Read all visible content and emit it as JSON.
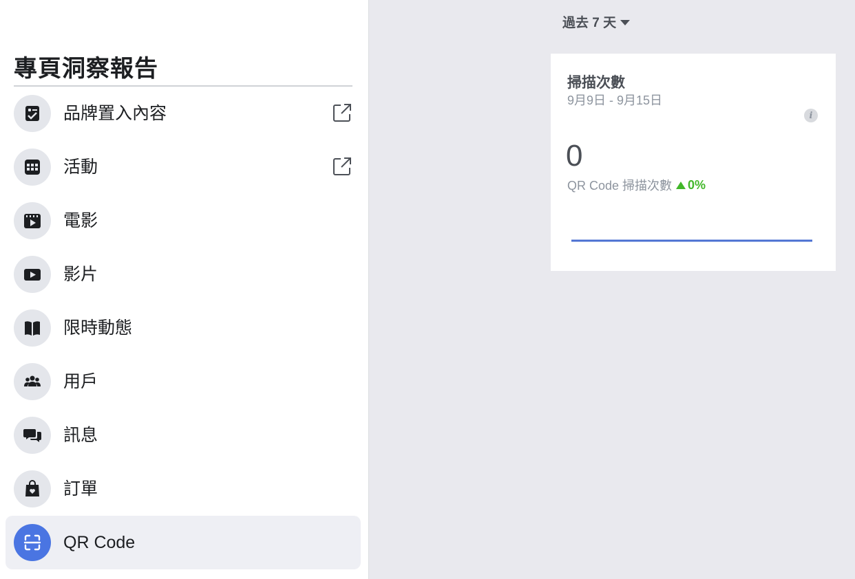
{
  "sidebar": {
    "title": "專頁洞察報告",
    "items": [
      {
        "label": "品牌置入內容",
        "icon": "branded-content-icon",
        "external": true
      },
      {
        "label": "活動",
        "icon": "calendar-icon",
        "external": true
      },
      {
        "label": "電影",
        "icon": "movie-icon",
        "external": false
      },
      {
        "label": "影片",
        "icon": "video-icon",
        "external": false
      },
      {
        "label": "限時動態",
        "icon": "book-icon",
        "external": false
      },
      {
        "label": "用戶",
        "icon": "people-icon",
        "external": false
      },
      {
        "label": "訊息",
        "icon": "chat-icon",
        "external": false
      },
      {
        "label": "訂單",
        "icon": "shopping-bag-icon",
        "external": false
      },
      {
        "label": "QR Code",
        "icon": "qr-scan-icon",
        "external": false,
        "active": true
      }
    ]
  },
  "main": {
    "date_range_label": "過去 7 天"
  },
  "card": {
    "title": "掃描次數",
    "date_range": "9月9日 - 9月15日",
    "info_glyph": "i",
    "value": "0",
    "metric_label": "QR Code 掃描次數",
    "change": "0%",
    "series": [
      0,
      0,
      0,
      0,
      0,
      0,
      0
    ]
  },
  "colors": {
    "accent": "#4a75e2",
    "trend_up": "#42b72a",
    "sparkline": "#4a6fd1"
  }
}
